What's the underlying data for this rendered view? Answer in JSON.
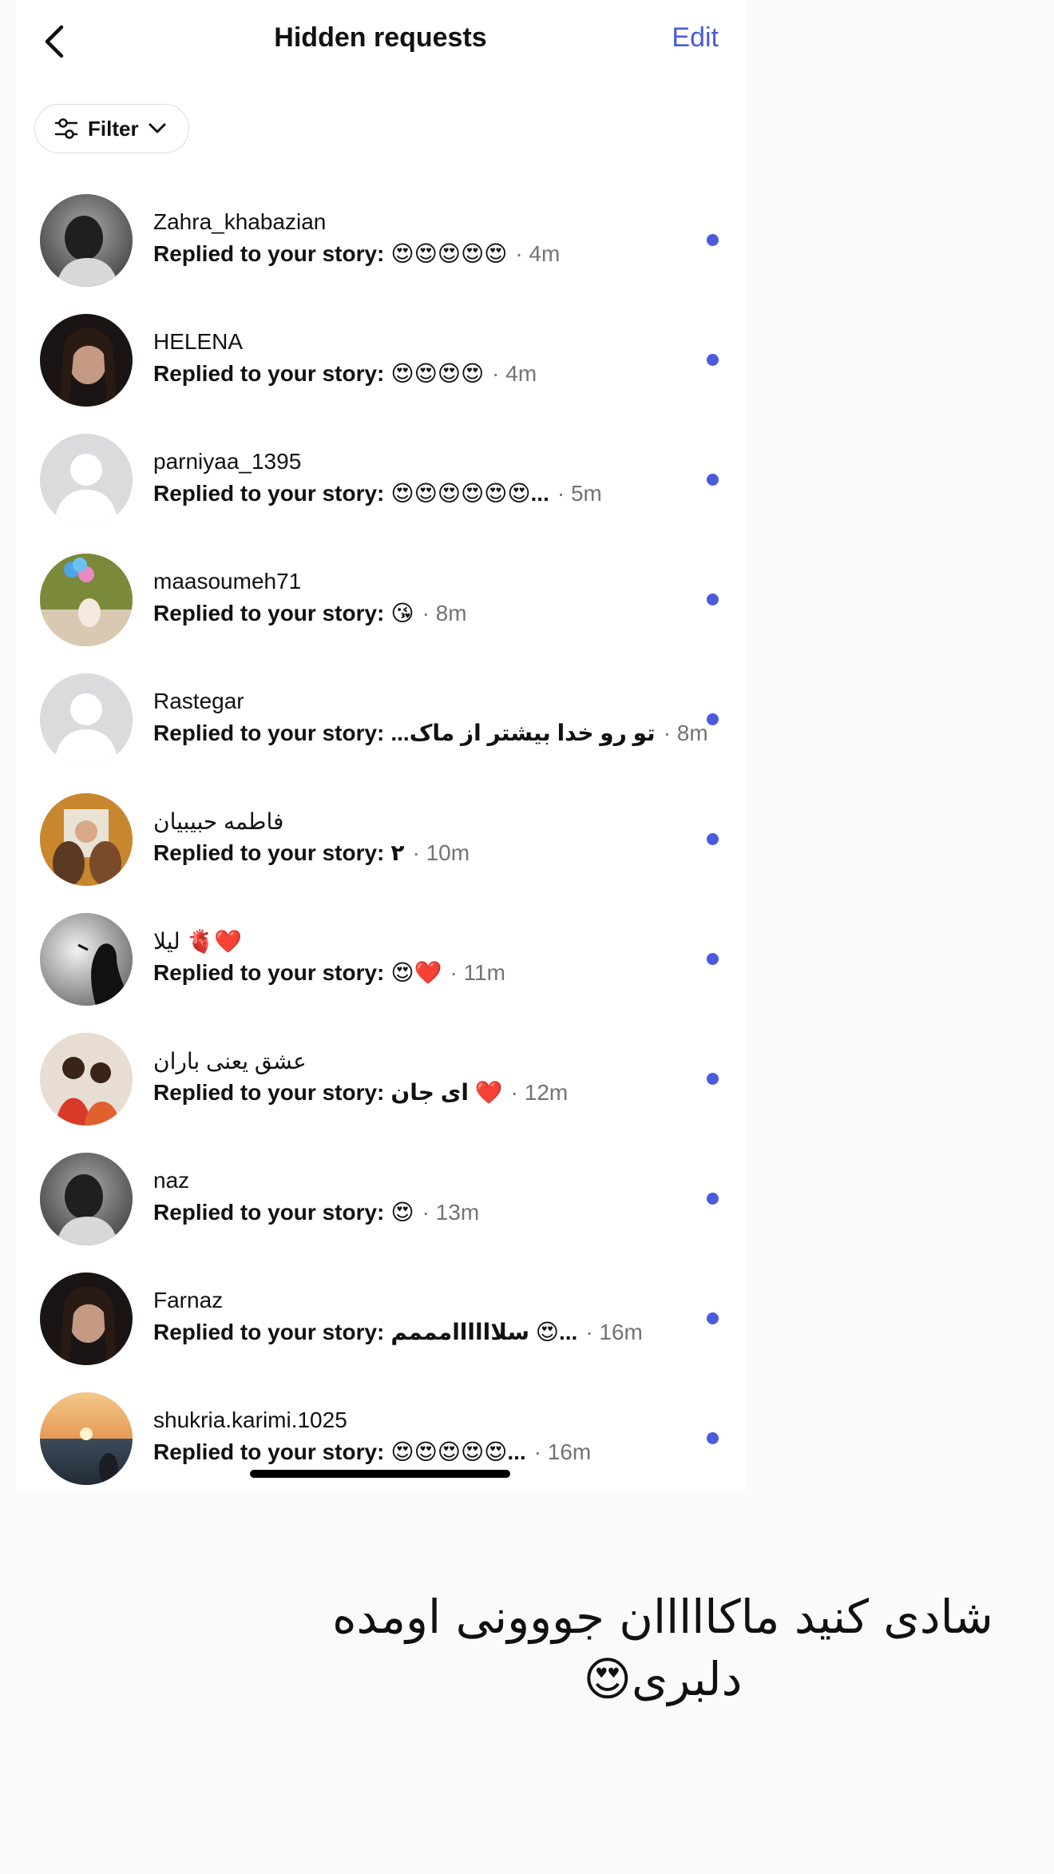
{
  "header": {
    "title": "Hidden requests",
    "edit_label": "Edit"
  },
  "filter": {
    "label": "Filter"
  },
  "requests": [
    {
      "username": "Zahra_khabazian",
      "prefix": "Replied to your story:",
      "message": "😍😍😍😍😍",
      "time": "· 4m",
      "unread": true,
      "avatar": "photo-gray"
    },
    {
      "username": "HELENA",
      "prefix": "Replied to your story:",
      "message": "😍😍😍😍",
      "time": "· 4m",
      "unread": true,
      "avatar": "photo-dark"
    },
    {
      "username": "parniyaa_1395",
      "prefix": "Replied to your story:",
      "message": "😍😍😍😍😍😍...",
      "time": "· 5m",
      "unread": true,
      "avatar": "default"
    },
    {
      "username": "maasoumeh71",
      "prefix": "Replied to your story:",
      "message": "😘",
      "time": "· 8m",
      "unread": true,
      "avatar": "photo-green"
    },
    {
      "username": "Rastegar",
      "prefix": "Replied to your story:",
      "message": "...تو رو خدا بیشتر از ماک",
      "time": "· 8m",
      "unread": true,
      "avatar": "default"
    },
    {
      "username": "فاطمه حبیبیان",
      "prefix": "Replied to your story:",
      "message": "۲",
      "time": "· 10m",
      "unread": true,
      "avatar": "photo-warm"
    },
    {
      "username": "لیلا 🫀❤️",
      "prefix": "Replied to your story:",
      "message": "😍❤️",
      "time": "· 11m",
      "unread": true,
      "avatar": "photo-silhouette"
    },
    {
      "username": "عشق یعنی باران",
      "prefix": "Replied to your story:",
      "message": "ای جان ❤️",
      "time": "· 12m",
      "unread": true,
      "avatar": "photo-red"
    },
    {
      "username": "naz",
      "prefix": "Replied to your story:",
      "message": "😍",
      "time": "· 13m",
      "unread": true,
      "avatar": "photo-gray"
    },
    {
      "username": "Farnaz",
      "prefix": "Replied to your story:",
      "message": "سلاااااامممم 😍...",
      "time": "· 16m",
      "unread": true,
      "avatar": "photo-dark"
    },
    {
      "username": "shukria.karimi.1025",
      "prefix": "Replied to your story:",
      "message": "😍😍😍😍😍...",
      "time": "· 16m",
      "unread": true,
      "avatar": "photo-sunset"
    }
  ],
  "caption": {
    "text": "شادی کنید ماکااااان جووونی اومده دلبری😍"
  },
  "colors": {
    "accent": "#4a5bdf",
    "muted": "#737373",
    "dot": "#4a5bdf"
  }
}
